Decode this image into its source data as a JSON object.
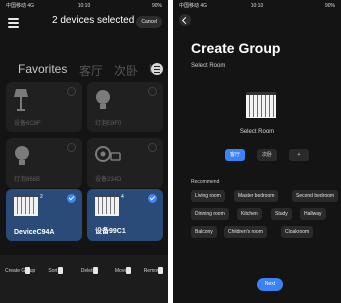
{
  "left": {
    "status": {
      "carrier": "中国移动 4G",
      "time": "10:10",
      "battery": "90%"
    },
    "header": {
      "title": "2 devices selected",
      "cancel_label": "Cancel"
    },
    "tabs": [
      {
        "label": "Favorites",
        "active": true
      },
      {
        "label": "客厅",
        "active": false
      },
      {
        "label": "次卧",
        "active": false
      },
      {
        "label": "U",
        "active": false
      }
    ],
    "devices": [
      {
        "name": "设备6C8F",
        "icon": "lamp-icon",
        "selected": false
      },
      {
        "name": "灯泡E8F0",
        "icon": "bulb-icon",
        "selected": false
      },
      {
        "name": "灯泡868B",
        "icon": "bulb-icon",
        "selected": false
      },
      {
        "name": "设备234D",
        "icon": "camera-icon",
        "selected": false
      },
      {
        "name": "DeviceC94A",
        "icon": "curtain-icon",
        "count": "2",
        "selected": true
      },
      {
        "name": "设备99C1",
        "icon": "curtain-icon",
        "count": "4",
        "selected": true
      }
    ],
    "toolbar": [
      {
        "label": "Create Group",
        "icon": "copy-icon"
      },
      {
        "label": "Sort",
        "icon": "sort-icon"
      },
      {
        "label": "Delete",
        "icon": "trash-icon"
      },
      {
        "label": "Move",
        "icon": "move-icon"
      },
      {
        "label": "Remove",
        "icon": "remove-icon"
      }
    ]
  },
  "right": {
    "status": {
      "carrier": "中国移动 4G",
      "time": "10:10",
      "battery": "90%"
    },
    "title": "Create Group",
    "subtitle": "Select Room",
    "room_label": "Select Room",
    "room_buttons": [
      {
        "label": "客厅",
        "active": true
      },
      {
        "label": "次卧",
        "active": false
      },
      {
        "label": "+",
        "active": false
      }
    ],
    "recommend_label": "Recommend",
    "recommend": [
      "Living room",
      "Master bedroom",
      "Second bedroom",
      "Dinning room",
      "Kitchen",
      "Study",
      "Hallway",
      "Balcony",
      "Children's room",
      "Cloakroom"
    ],
    "next_label": "Next",
    "accent": "#3b82f6"
  }
}
